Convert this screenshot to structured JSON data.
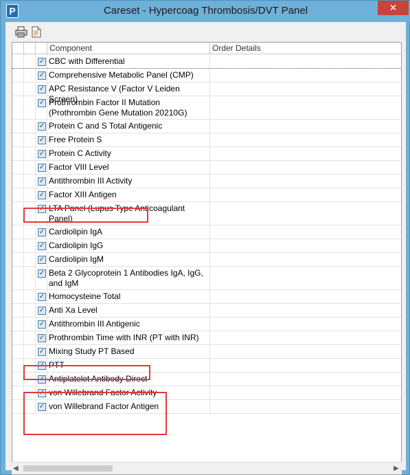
{
  "window": {
    "title": "Careset - Hypercoag Thrombosis/DVT Panel",
    "app_icon_letter": "P",
    "close_glyph": "✕"
  },
  "toolbar": {
    "print_icon": "printer-icon",
    "details_icon": "document-icon"
  },
  "grid": {
    "columns": [
      "Component",
      "Order Details"
    ],
    "rows": [
      {
        "label": "CBC with Differential",
        "checked": true
      },
      {
        "label": "Comprehensive Metabolic Panel (CMP)",
        "checked": true
      },
      {
        "label": "APC Resistance V (Factor V Leiden Screen)",
        "checked": true
      },
      {
        "label": "Prothrombin Factor II Mutation (Prothrombin Gene Mutation 20210G)",
        "checked": true
      },
      {
        "label": "Protein C and S Total Antigenic",
        "checked": true
      },
      {
        "label": "Free Protein S",
        "checked": true
      },
      {
        "label": "Protein C Activity",
        "checked": true
      },
      {
        "label": "Factor VIII Level",
        "checked": true
      },
      {
        "label": "Antithrombin III Activity",
        "checked": true
      },
      {
        "label": "Factor XIII Antigen",
        "checked": true
      },
      {
        "label": "LTA Panel (Lupus Type Anticoagulant Panel)",
        "checked": true
      },
      {
        "label": "Cardiolipin IgA",
        "checked": true
      },
      {
        "label": "Cardiolipin IgG",
        "checked": true
      },
      {
        "label": "Cardiolipin IgM",
        "checked": true
      },
      {
        "label": "Beta 2 Glycoprotein 1 Antibodies IgA, IgG, and IgM",
        "checked": true
      },
      {
        "label": "Homocysteine Total",
        "checked": true
      },
      {
        "label": "Anti Xa Level",
        "checked": true
      },
      {
        "label": "Antithrombin III Antigenic",
        "checked": true
      },
      {
        "label": "Prothrombin Time with INR (PT with INR)",
        "checked": true
      },
      {
        "label": "Mixing Study PT Based",
        "checked": true
      },
      {
        "label": "PTT",
        "checked": true
      },
      {
        "label": "Antiplatelet Antibody Direct",
        "checked": true
      },
      {
        "label": "von Willebrand Factor Activity",
        "checked": true
      },
      {
        "label": "von Willebrand Factor Antigen",
        "checked": true
      }
    ]
  },
  "colors": {
    "highlight": "#e0393c",
    "title_bar": "#6fb0d8",
    "close_button": "#c7443c"
  },
  "scrollbar": {
    "left_arrow": "◀",
    "right_arrow": "▶"
  }
}
